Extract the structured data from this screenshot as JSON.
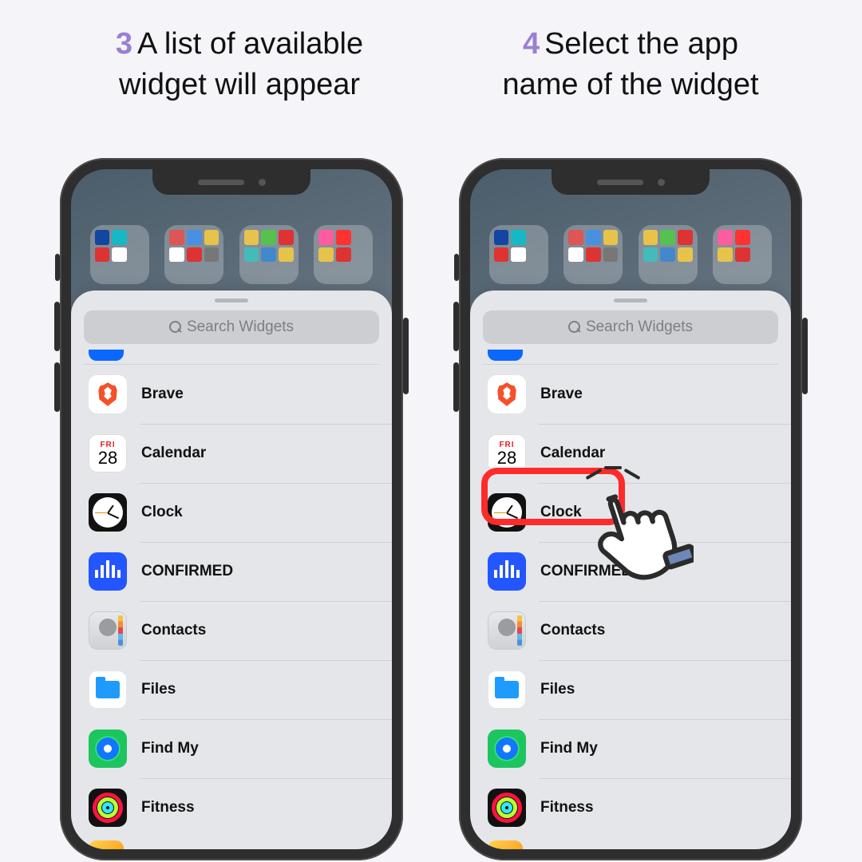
{
  "captions": {
    "step3": {
      "num": "3",
      "line1": "A list of available",
      "line2": "widget will appear"
    },
    "step4": {
      "num": "4",
      "line1": "Select the app",
      "line2": "name of the widget"
    }
  },
  "search": {
    "placeholder": "Search Widgets"
  },
  "calendar_icon": {
    "weekday": "FRI",
    "day": "28"
  },
  "apps": [
    {
      "key": "brave",
      "label": "Brave"
    },
    {
      "key": "calendar",
      "label": "Calendar"
    },
    {
      "key": "clock",
      "label": "Clock"
    },
    {
      "key": "confirmed",
      "label": "CONFIRMED"
    },
    {
      "key": "contacts",
      "label": "Contacts"
    },
    {
      "key": "files",
      "label": "Files"
    },
    {
      "key": "findmy",
      "label": "Find My"
    },
    {
      "key": "fitness",
      "label": "Fitness"
    }
  ],
  "highlight_target": "clock"
}
